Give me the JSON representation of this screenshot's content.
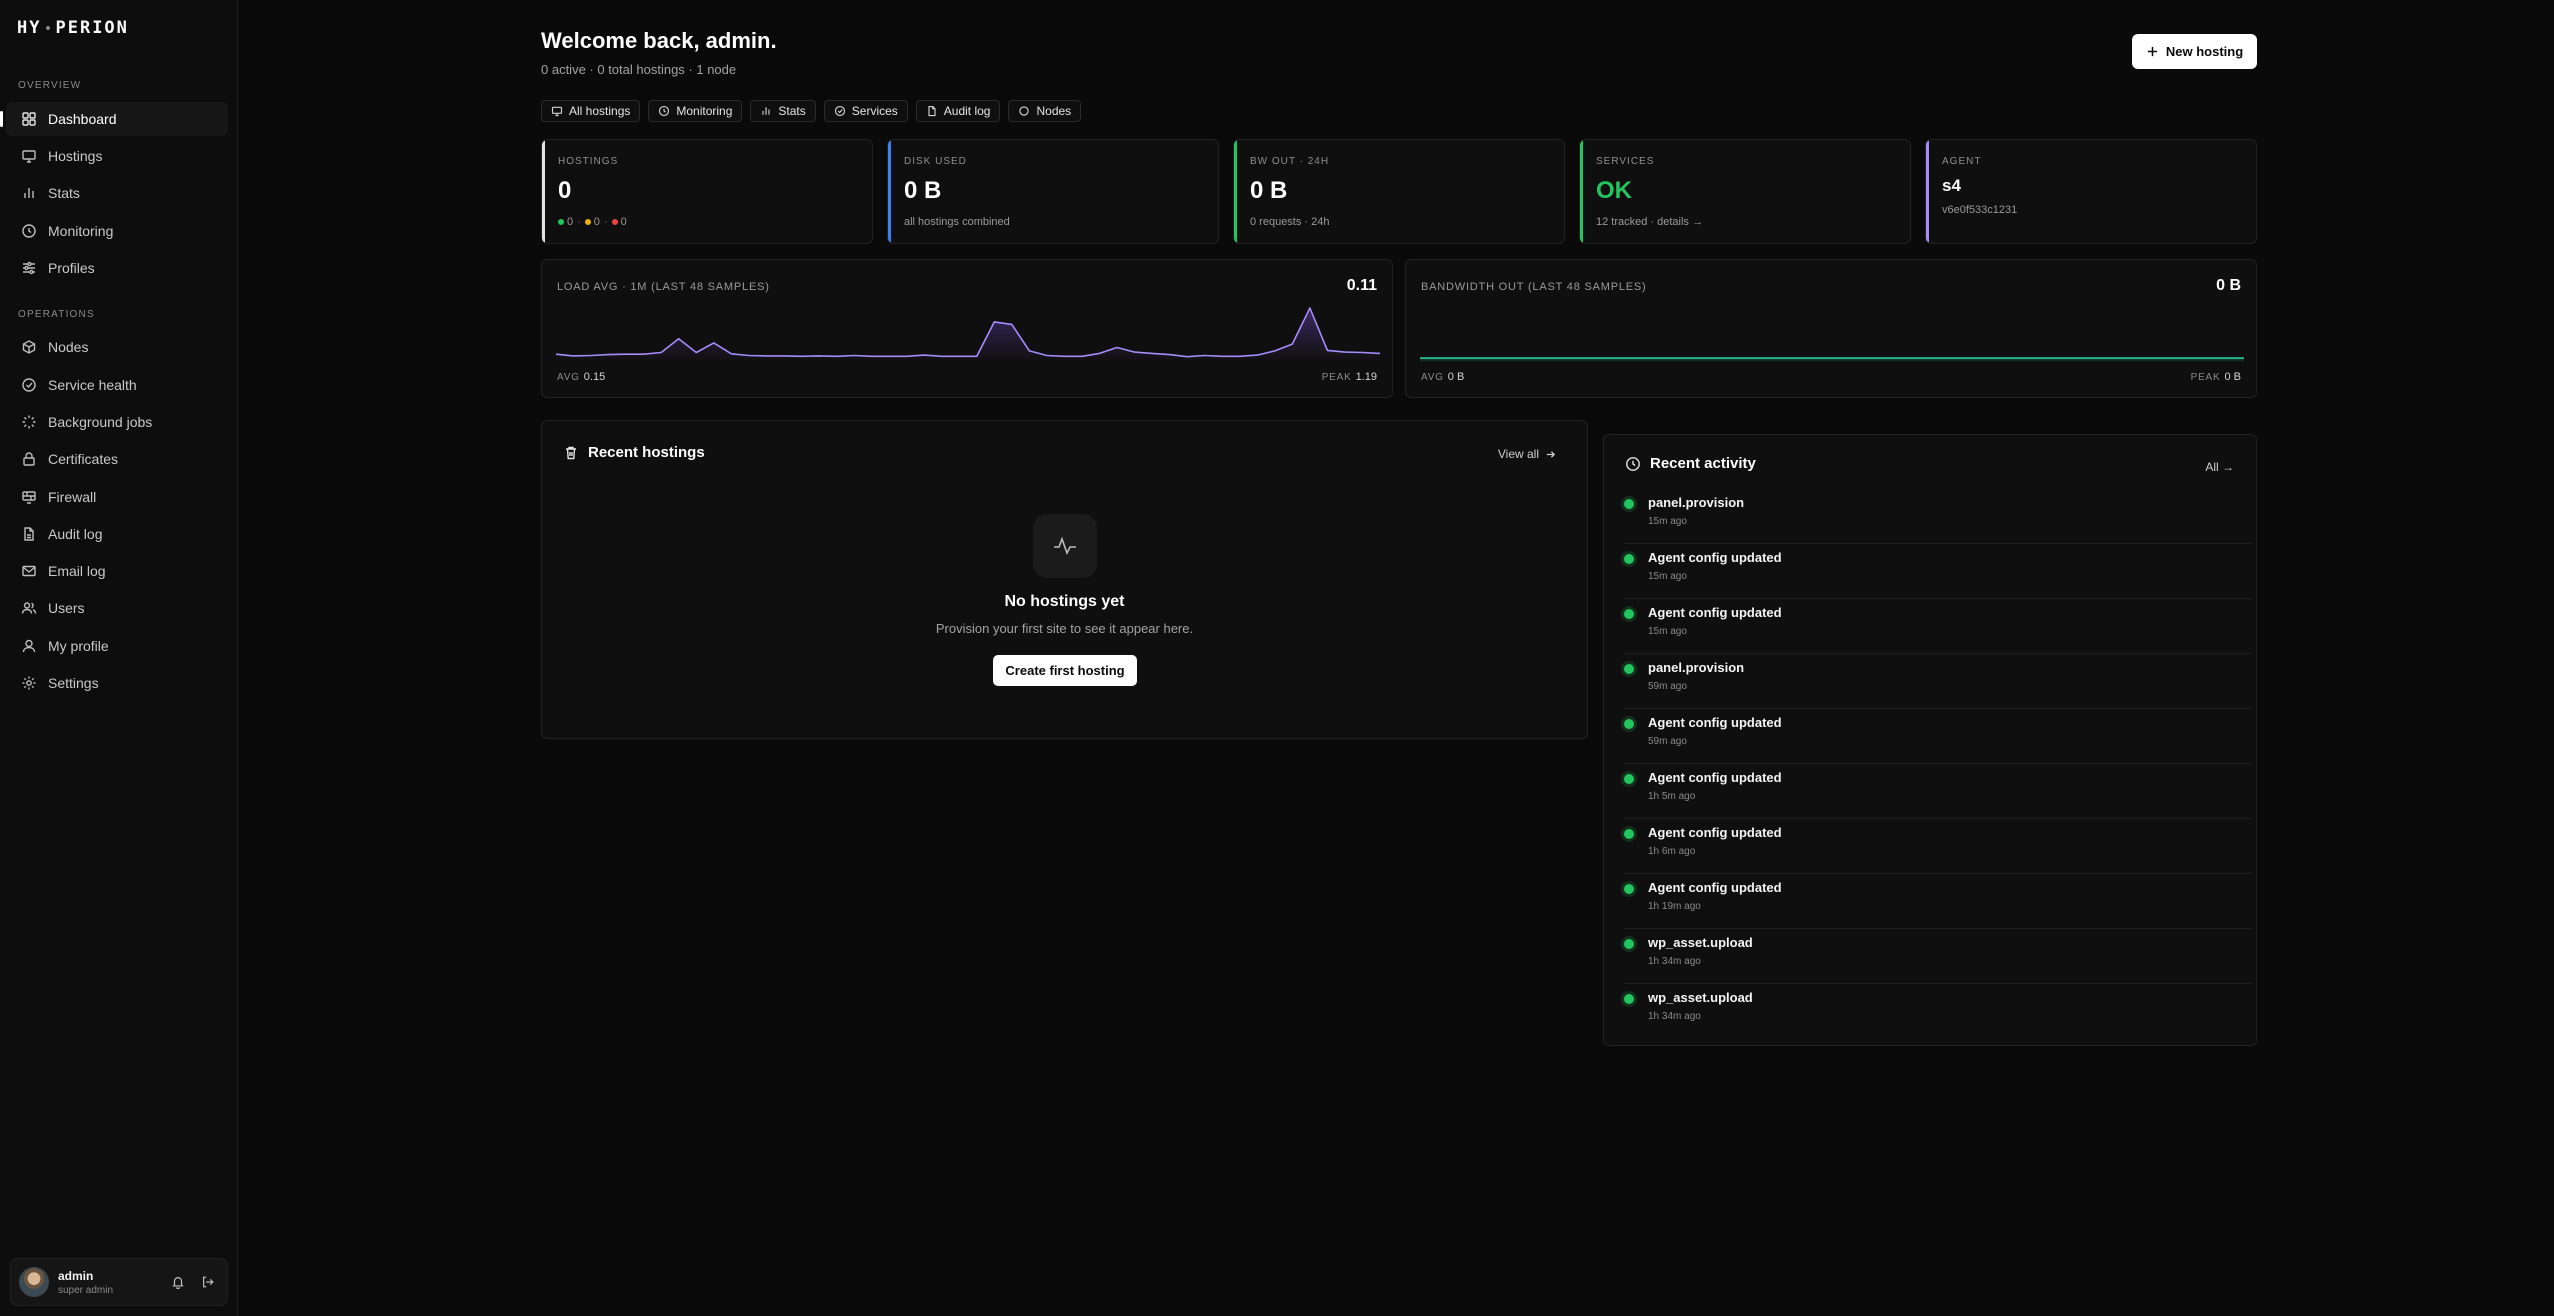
{
  "brand": {
    "left": "HY",
    "right": "PERION"
  },
  "sidebar": {
    "sections": [
      {
        "label": "OVERVIEW",
        "items": [
          {
            "label": "Dashboard",
            "icon": "dashboard-icon",
            "active": true
          },
          {
            "label": "Hostings",
            "icon": "monitor-icon"
          },
          {
            "label": "Stats",
            "icon": "bar-chart-icon"
          },
          {
            "label": "Monitoring",
            "icon": "clock-icon"
          },
          {
            "label": "Profiles",
            "icon": "sliders-icon"
          }
        ]
      },
      {
        "label": "OPERATIONS",
        "items": [
          {
            "label": "Nodes",
            "icon": "box-icon"
          },
          {
            "label": "Service health",
            "icon": "check-circle-icon"
          },
          {
            "label": "Background jobs",
            "icon": "loader-icon"
          },
          {
            "label": "Certificates",
            "icon": "lock-icon"
          },
          {
            "label": "Firewall",
            "icon": "firewall-icon"
          },
          {
            "label": "Audit log",
            "icon": "file-icon"
          },
          {
            "label": "Email log",
            "icon": "mail-icon"
          },
          {
            "label": "Users",
            "icon": "users-icon"
          },
          {
            "label": "My profile",
            "icon": "user-icon"
          },
          {
            "label": "Settings",
            "icon": "gear-icon"
          }
        ]
      }
    ],
    "user": {
      "name": "admin",
      "role": "super admin"
    }
  },
  "header": {
    "title": "Welcome back, admin.",
    "subtitle": "0 active · 0 total hostings · 1 node",
    "new_button": "New hosting"
  },
  "quick_links": [
    {
      "label": "All hostings",
      "icon": "monitor-icon"
    },
    {
      "label": "Monitoring",
      "icon": "clock-icon"
    },
    {
      "label": "Stats",
      "icon": "bar-chart-icon"
    },
    {
      "label": "Services",
      "icon": "check-circle-icon"
    },
    {
      "label": "Audit log",
      "icon": "file-icon"
    },
    {
      "label": "Nodes",
      "icon": "circle-icon"
    }
  ],
  "stats": {
    "hostings": {
      "label": "HOSTINGS",
      "value": "0",
      "green": "0",
      "yellow": "0",
      "red": "0"
    },
    "disk": {
      "label": "DISK USED",
      "value": "0 B",
      "sub": "all hostings combined"
    },
    "bw": {
      "label": "BW OUT · 24H",
      "value": "0 B",
      "sub": "0 requests · 24h"
    },
    "services": {
      "label": "SERVICES",
      "value": "OK",
      "sub": "12 tracked · details →"
    },
    "agent": {
      "label": "AGENT",
      "value": "s4",
      "sub": "v6e0f533c1231"
    }
  },
  "colors": {
    "accent_hostings": "#e5e5e5",
    "accent_disk": "#3b82f6",
    "accent_bw": "#22c55e",
    "accent_services": "#22c55e",
    "accent_agent": "#a78bfa",
    "status_green": "#22c55e",
    "status_yellow": "#eab308",
    "status_red": "#ef4444"
  },
  "charts": {
    "load": {
      "title": "LOAD AVG · 1M (LAST 48 SAMPLES)",
      "value": "0.11",
      "avg_label": "AVG",
      "avg": "0.15",
      "peak_label": "PEAK",
      "peak": "1.19"
    },
    "bandwidth": {
      "title": "BANDWIDTH OUT (LAST 48 SAMPLES)",
      "value": "0 B",
      "avg_label": "AVG",
      "avg": "0 B",
      "peak_label": "PEAK",
      "peak": "0 B"
    }
  },
  "chart_data": [
    {
      "type": "area",
      "series": [
        {
          "values": [
            0.09,
            0.05,
            0.06,
            0.08,
            0.09,
            0.09,
            0.13,
            0.46,
            0.13,
            0.36,
            0.1,
            0.06,
            0.05,
            0.05,
            0.04,
            0.05,
            0.04,
            0.06,
            0.04,
            0.04,
            0.04,
            0.07,
            0.04,
            0.04,
            0.04,
            0.86,
            0.8,
            0.17,
            0.06,
            0.04,
            0.04,
            0.11,
            0.25,
            0.14,
            0.11,
            0.08,
            0.03,
            0.06,
            0.04,
            0.04,
            0.07,
            0.17,
            0.33,
            1.19,
            0.18,
            0.14,
            0.13,
            0.11
          ]
        }
      ],
      "ylim": [
        0,
        1.19
      ]
    },
    {
      "type": "area",
      "series": [
        {
          "values": [
            0,
            0,
            0,
            0,
            0,
            0,
            0,
            0,
            0,
            0,
            0,
            0,
            0,
            0,
            0,
            0,
            0,
            0,
            0,
            0,
            0,
            0,
            0,
            0,
            0,
            0,
            0,
            0,
            0,
            0,
            0,
            0,
            0,
            0,
            0,
            0,
            0,
            0,
            0,
            0,
            0,
            0,
            0,
            0,
            0,
            0,
            0,
            0
          ]
        }
      ],
      "ylim": [
        0,
        1
      ]
    }
  ],
  "recent_hostings": {
    "title": "Recent hostings",
    "view_all": "View all",
    "empty_title": "No hostings yet",
    "empty_text": "Provision your first site to see it appear here.",
    "create_button": "Create first hosting"
  },
  "activity": {
    "title": "Recent activity",
    "all_link": "All →",
    "items": [
      {
        "title": "panel.provision",
        "time": "15m ago"
      },
      {
        "title": "Agent config updated",
        "time": "15m ago"
      },
      {
        "title": "Agent config updated",
        "time": "15m ago"
      },
      {
        "title": "panel.provision",
        "time": "59m ago"
      },
      {
        "title": "Agent config updated",
        "time": "59m ago"
      },
      {
        "title": "Agent config updated",
        "time": "1h 5m ago"
      },
      {
        "title": "Agent config updated",
        "time": "1h 6m ago"
      },
      {
        "title": "Agent config updated",
        "time": "1h 19m ago"
      },
      {
        "title": "wp_asset.upload",
        "time": "1h 34m ago"
      },
      {
        "title": "wp_asset.upload",
        "time": "1h 34m ago"
      }
    ]
  }
}
